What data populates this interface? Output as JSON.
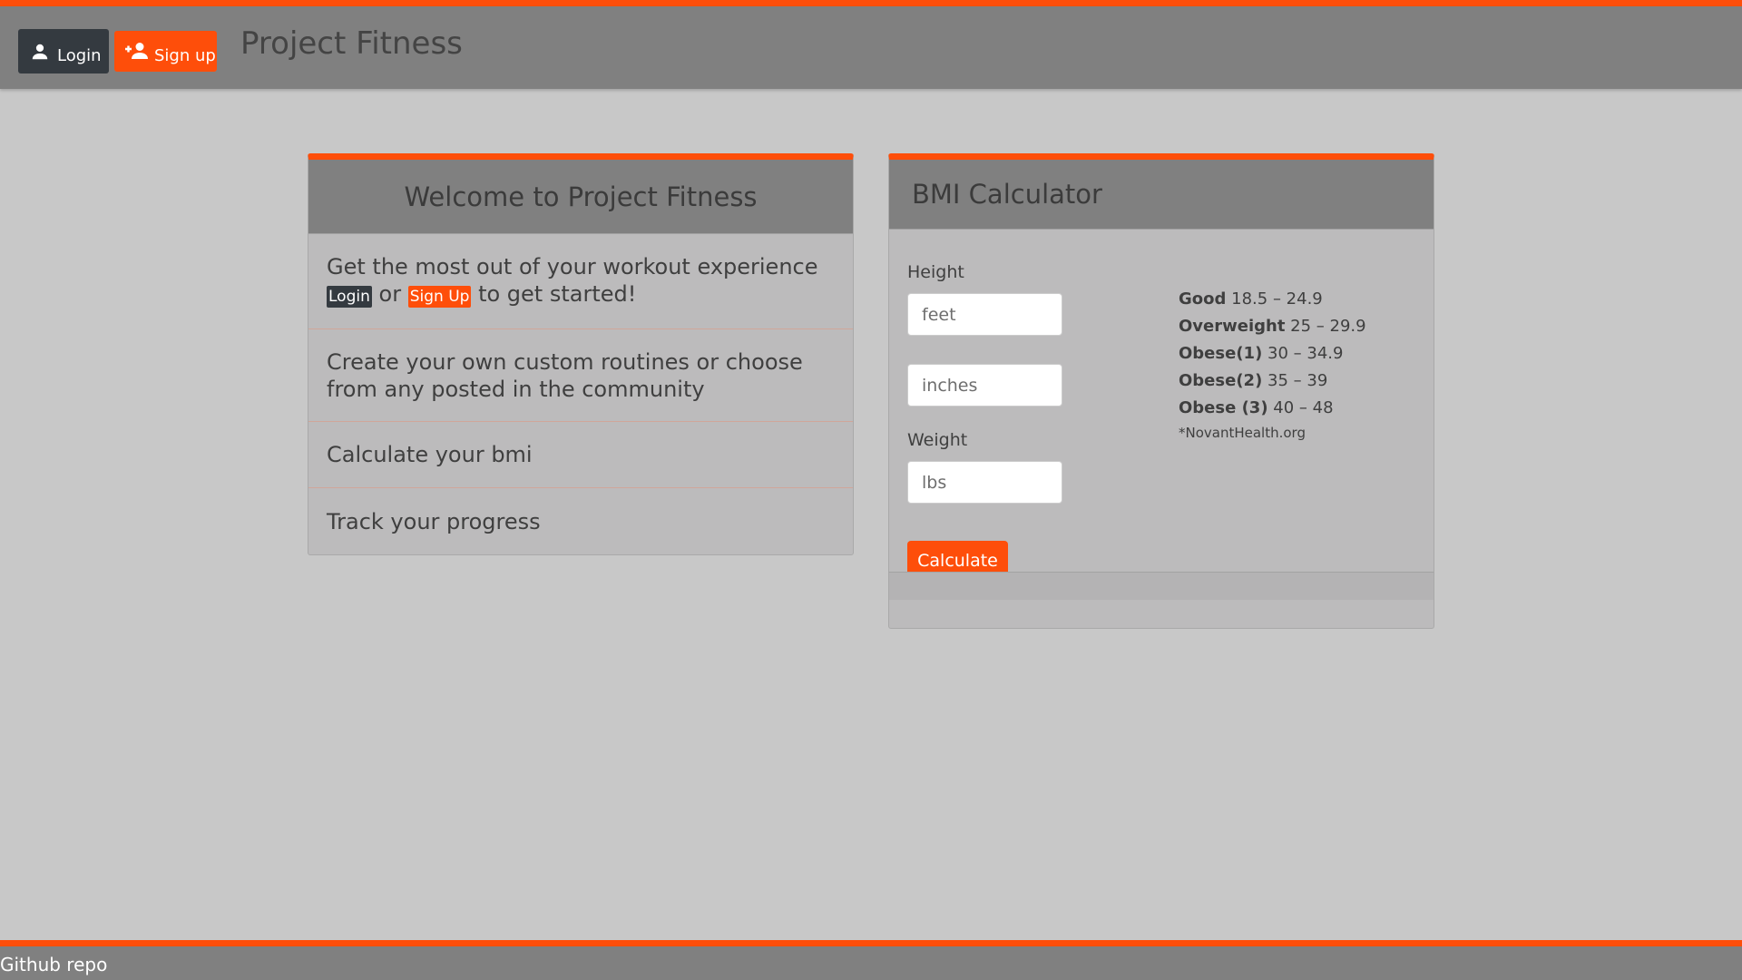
{
  "navbar": {
    "login_label": "Login",
    "signup_label": "Sign up",
    "brand": "Project Fitness"
  },
  "welcome": {
    "title": "Welcome to Project Fitness",
    "item1_prefix": "Get the most out of your workout experience",
    "item1_login": "Login",
    "item1_or": "or",
    "item1_signup": "Sign Up",
    "item1_suffix": "to get started!",
    "item2": "Create your own custom routines or choose from any posted in the community",
    "item3": "Calculate your bmi",
    "item4": "Track your progress"
  },
  "bmi": {
    "title": "BMI Calculator",
    "height_label": "Height",
    "feet_placeholder": "feet",
    "inches_placeholder": "inches",
    "weight_label": "Weight",
    "lbs_placeholder": "lbs",
    "calculate_label": "Calculate",
    "ranges": [
      {
        "category": "Good",
        "range": "18.5 – 24.9"
      },
      {
        "category": "Overweight",
        "range": "25 – 29.9"
      },
      {
        "category": "Obese(1)",
        "range": "30 – 34.9"
      },
      {
        "category": "Obese(2)",
        "range": "35 – 39"
      },
      {
        "category": "Obese (3)",
        "range": "40 – 48"
      }
    ],
    "source": "*NovantHealth.org"
  },
  "footer": {
    "github_label": "Github repo"
  },
  "colors": {
    "accent": "#fe4e0a",
    "dark_button": "#343a40",
    "header_gray": "#808080",
    "page_bg": "#c8c8c8"
  }
}
